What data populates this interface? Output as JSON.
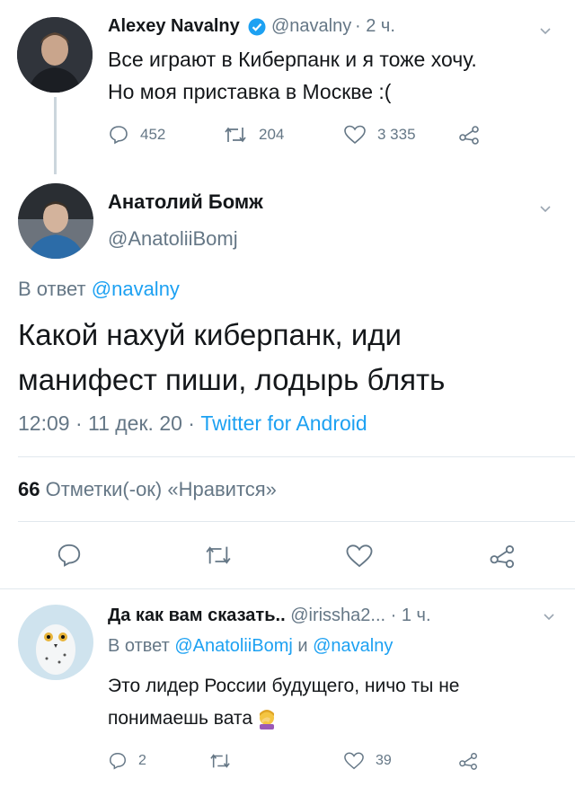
{
  "tweet1": {
    "name": "Alexey Navalny",
    "handle": "@navalny",
    "time": "· 2 ч.",
    "text_line1": "Все играют в Киберпанк и я тоже хочу.",
    "text_line2": "Но моя приставка в Москве :(",
    "replies": "452",
    "retweets": "204",
    "likes": "3 335"
  },
  "main": {
    "name": "Анатолий Бомж",
    "handle": "@AnatoliiBomj",
    "reply_prefix": "В ответ",
    "reply_to": "@navalny",
    "text_line1": "Какой нахуй киберпанк, иди",
    "text_line2": "манифест пиши, лодырь блять",
    "timestamp": "12:09 · 11 дек. 20 ·",
    "client": "Twitter for Android",
    "likes_count": "66",
    "likes_label": "Отметки(-ок) «Нравится»"
  },
  "reply": {
    "name": "Да как вам сказать..",
    "handle": "@irissha2...",
    "time": "· 1 ч.",
    "reply_prefix": "В ответ",
    "reply_to1": "@AnatoliiBomj",
    "reply_and": "и",
    "reply_to2": "@navalny",
    "text_line1": "Это лидер России будущего, ничо ты не",
    "text_line2": "понимаешь вата",
    "replies": "2",
    "likes": "39"
  },
  "colors": {
    "accent": "#1da1f2",
    "secondary": "#657786",
    "divider": "#e1e8ed"
  }
}
